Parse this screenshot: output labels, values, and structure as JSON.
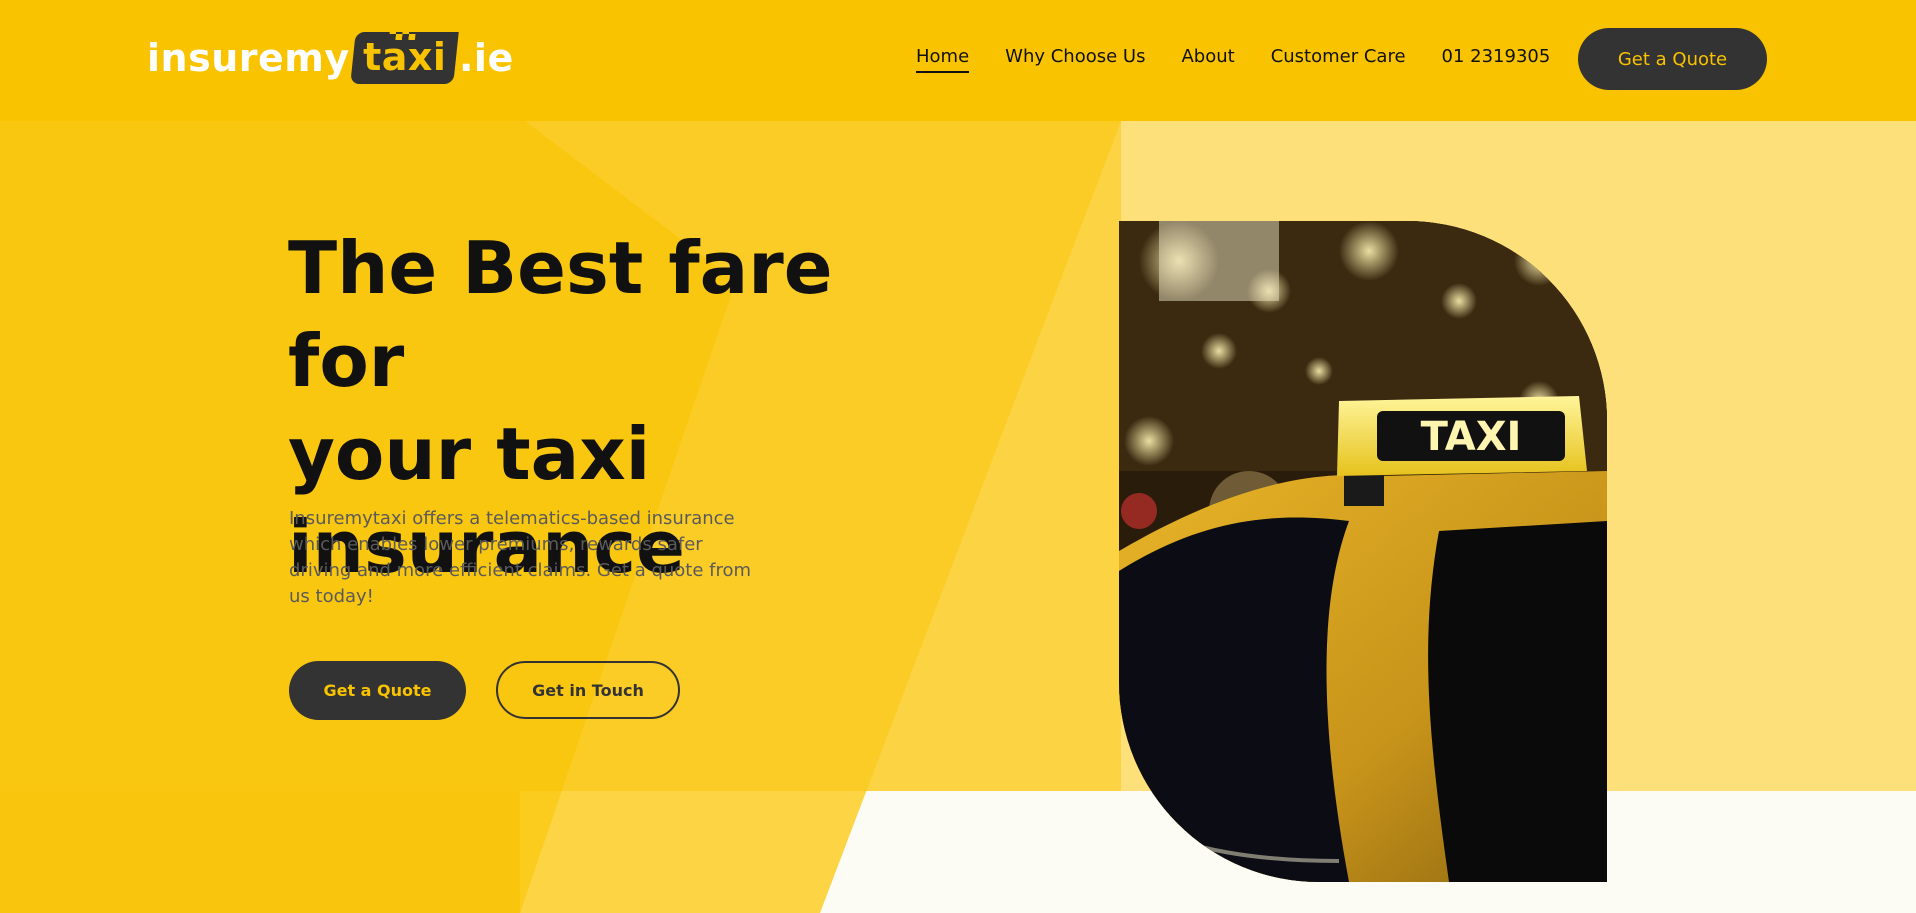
{
  "brand": {
    "logo_pre": "insuremy",
    "logo_box": "taxi",
    "logo_post": ".ie"
  },
  "nav": {
    "items": [
      "Home",
      "Why Choose Us",
      "About",
      "Customer Care",
      "01 2319305"
    ],
    "active": "Home",
    "cta_label": "Get a Quote"
  },
  "hero": {
    "title_line1": "The Best fare for",
    "title_line2": "your taxi",
    "title_line3": "insurance",
    "description": "Insuremytaxi offers a telematics-based insurance which enables lower premiums, rewards safer driving and more efficient claims. Get a quote from us today!",
    "primary_button": "Get a Quote",
    "secondary_button": "Get in Touch"
  },
  "image": {
    "sign_text": "TAXI"
  },
  "colors": {
    "brand_yellow": "#f9c300",
    "dark": "#333333",
    "light_yellow": "#fde07a"
  }
}
